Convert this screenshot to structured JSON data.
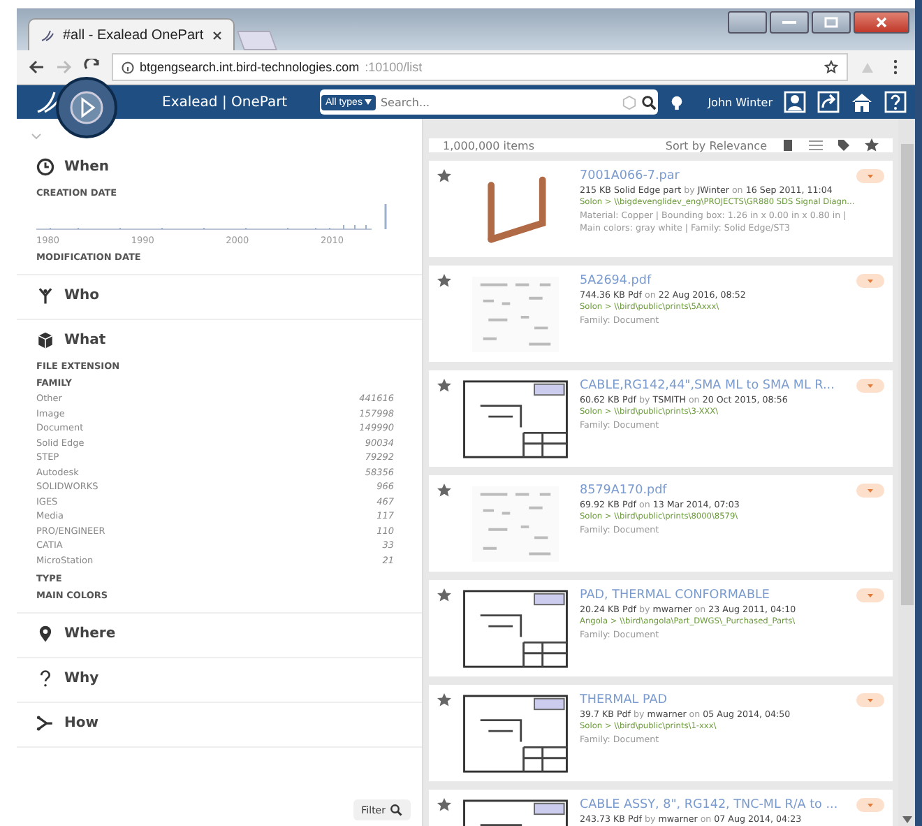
{
  "browser": {
    "tab_title": "#all - Exalead OnePart",
    "url_host": "btgengsearch.int.bird-technologies.com",
    "url_rest": ":10100/list"
  },
  "header": {
    "app_name": "Exalead | OnePart",
    "type_filter": "All types",
    "search": {
      "placeholder": "Search..."
    },
    "user": "John Winter"
  },
  "facets": {
    "sections": [
      {
        "kind": "when",
        "title": "When",
        "groups": [
          {
            "label": "CREATION DATE",
            "axis_labels": [
              "1980",
              "1990",
              "2000",
              "2010"
            ]
          },
          {
            "label": "MODIFICATION DATE"
          }
        ]
      },
      {
        "kind": "who",
        "title": "Who"
      },
      {
        "kind": "what",
        "title": "What",
        "groups": [
          {
            "label": "FILE EXTENSION"
          },
          {
            "label": "FAMILY",
            "items": [
              {
                "name": "Other",
                "count": "441616"
              },
              {
                "name": "Image",
                "count": "157998"
              },
              {
                "name": "Document",
                "count": "149990"
              },
              {
                "name": "Solid Edge",
                "count": "90034"
              },
              {
                "name": "STEP",
                "count": "79292"
              },
              {
                "name": "Autodesk",
                "count": "58356"
              },
              {
                "name": "SOLIDWORKS",
                "count": "966"
              },
              {
                "name": "IGES",
                "count": "467"
              },
              {
                "name": "Media",
                "count": "117"
              },
              {
                "name": "PRO/ENGINEER",
                "count": "110"
              },
              {
                "name": "CATIA",
                "count": "33"
              },
              {
                "name": "MicroStation",
                "count": "21"
              }
            ]
          },
          {
            "label": "TYPE"
          },
          {
            "label": "MAIN COLORS"
          }
        ]
      },
      {
        "kind": "where",
        "title": "Where"
      },
      {
        "kind": "why",
        "title": "Why"
      },
      {
        "kind": "how",
        "title": "How"
      }
    ],
    "filter_button": "Filter"
  },
  "results": {
    "count": "1,000,000 items",
    "sort": "Sort by Relevance",
    "items": [
      {
        "kind": "pipe",
        "title": "7001A066-7.par",
        "meta": "**215 KB Solid Edge part** by **JWinter** on **16 Sep 2011, 11:04**",
        "path": "Solon > \\\\bigdevenglidev_eng\\PROJECTS\\GR880 SDS Signal Diagn...",
        "details": "Material: Copper | Bounding box: 1.26 in x 0.00 in x 0.80 in | Main colors: gray white | Family: Solid Edge/ST3"
      },
      {
        "kind": "sheet",
        "title": "5A2694.pdf",
        "meta": "**744.36 KB Pdf** on **22 Aug 2016, 08:52**",
        "path": "Solon > \\\\bird\\public\\prints\\5Axxx\\",
        "details": "Family: Document"
      },
      {
        "kind": "drawing",
        "title": "CABLE,RG142,44\",SMA ML to SMA ML R...",
        "meta": "**60.62 KB Pdf** by **TSMITH** on **20 Oct 2015, 08:56**",
        "path": "Solon > \\\\bird\\public\\prints\\3-XXX\\",
        "details": "Family: Document"
      },
      {
        "kind": "sheet",
        "title": "8579A170.pdf",
        "meta": "**69.92 KB Pdf** on **13 Mar 2014, 07:03**",
        "path": "Solon > \\\\bird\\public\\prints\\8000\\8579\\",
        "details": "Family: Document"
      },
      {
        "kind": "drawing",
        "title": "PAD, THERMAL CONFORMABLE",
        "meta": "**20.24 KB Pdf** by **mwarner** on **23 Aug 2011, 04:10**",
        "path": "Angola > \\\\bird\\angola\\Part_DWGS\\_Purchased_Parts\\",
        "details": "Family: Document"
      },
      {
        "kind": "drawing",
        "title": "THERMAL PAD",
        "meta": "**39.7 KB Pdf** by **mwarner** on **05 Aug 2014, 04:50**",
        "path": "Solon > \\\\bird\\public\\prints\\1-xxx\\",
        "details": "Family: Document"
      },
      {
        "kind": "drawing",
        "title": "CABLE ASSY, 8\", RG142, TNC-ML R/A to ...",
        "meta": "**243.73 KB Pdf** by **mwarner** on **07 Aug 2014, 04:23**"
      }
    ]
  }
}
